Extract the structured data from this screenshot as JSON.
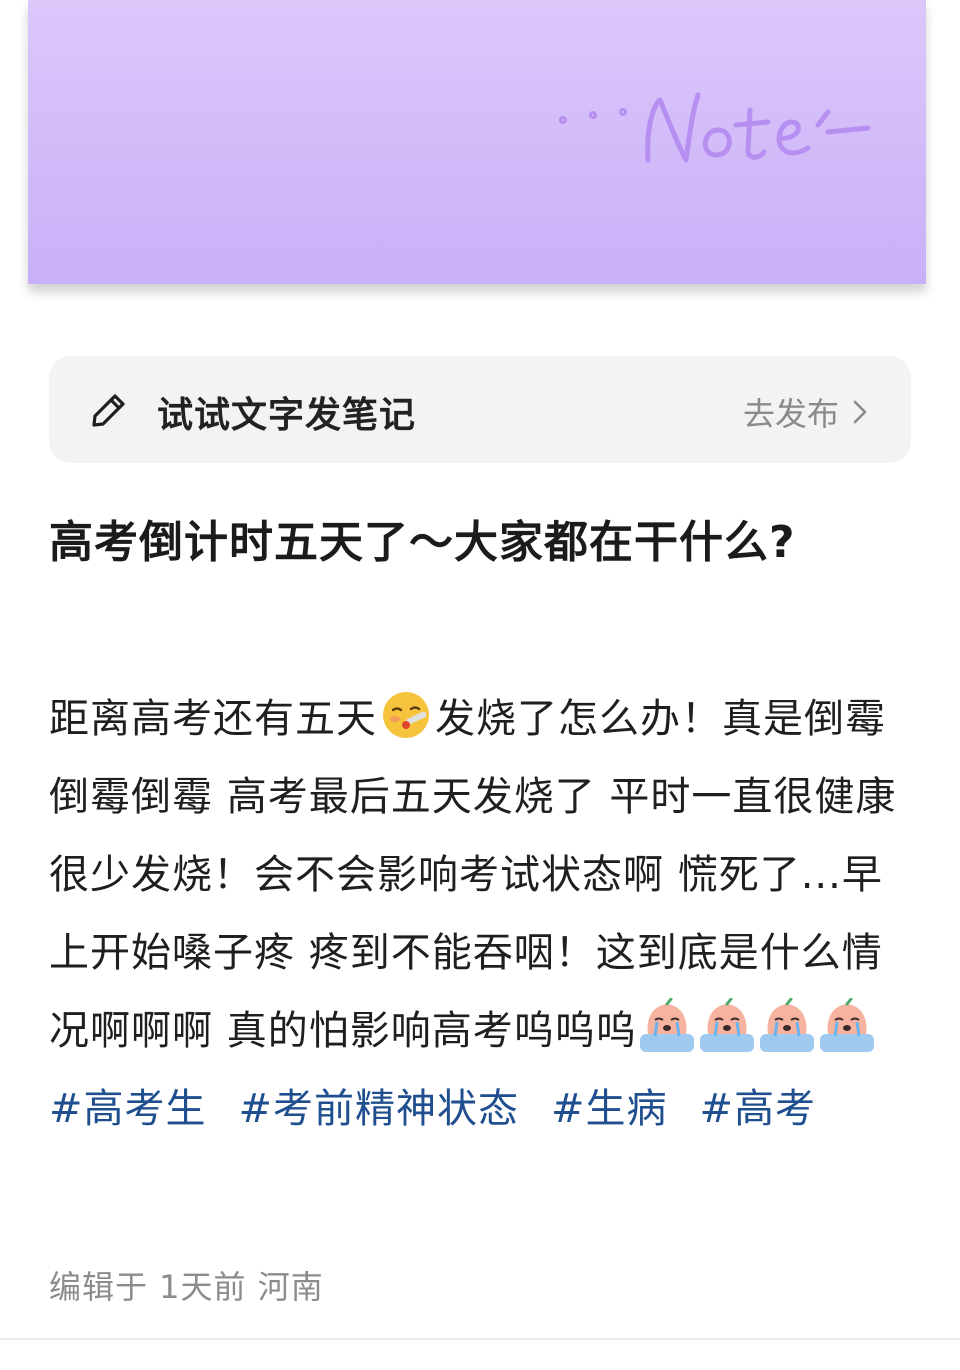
{
  "note_card": {
    "handwriting": "···Note"
  },
  "compose": {
    "label": "试试文字发笔记",
    "action": "去发布"
  },
  "post": {
    "title": "高考倒计时五天了～大家都在干什么?",
    "body_a": "距离高考还有五天",
    "body_b": "发烧了怎么办！真是倒霉倒霉倒霉 高考最后五天发烧了 平时一直很健康很少发烧！会不会影响考试状态啊 慌死了...早上开始嗓子疼 疼到不能吞咽！这到底是什么情况啊啊啊 真的怕影响高考呜呜呜",
    "hashtags": [
      "#高考生",
      "#考前精神状态",
      "#生病",
      "#高考"
    ],
    "meta": "编辑于 1天前 河南"
  },
  "icons": {
    "compose": "pencil-icon",
    "action": "chevron-right-icon",
    "emoji_face": "thermometer-face-emoji",
    "emoji_crying": "crying-peach-emoji"
  },
  "colors": {
    "accent": "#c9b0f7",
    "hashtag": "#1f4f8f",
    "muted": "#8c8c8c"
  }
}
